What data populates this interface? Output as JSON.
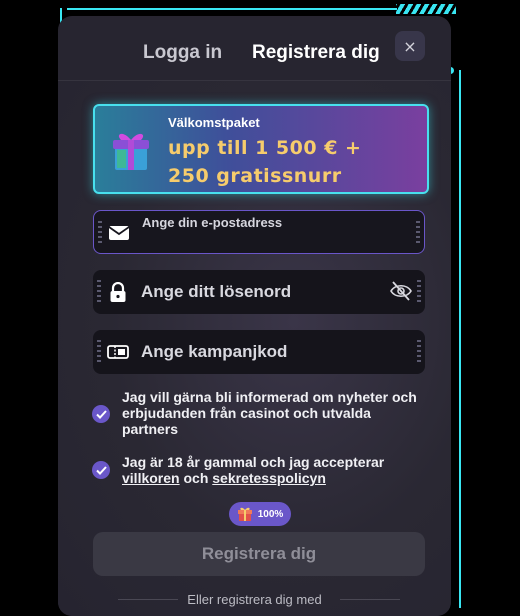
{
  "tabs": {
    "login": "Logga in",
    "register": "Registrera dig"
  },
  "close_icon": "×",
  "banner": {
    "title": "Välkomstpaket",
    "offer": "upp till 1 500 € + 250 gratissnurr",
    "icon": "gift-icon"
  },
  "fields": {
    "email": {
      "label": "Ange din e-postadress",
      "icon": "mail-icon"
    },
    "password": {
      "placeholder": "Ange ditt lösenord",
      "icon": "lock-icon",
      "toggle_icon": "eye-off-icon"
    },
    "promo": {
      "placeholder": "Ange kampanjkod",
      "icon": "ticket-icon"
    }
  },
  "consents": {
    "marketing": {
      "text": "Jag vill gärna bli informerad om nyheter och erbjudanden från casinot och utvalda partners",
      "checked": true
    },
    "terms": {
      "prefix": "Jag är 18 år gammal och jag accepterar ",
      "terms_link": "villkoren",
      "middle": " och ",
      "privacy_link": "sekretesspolicyn",
      "checked": true
    }
  },
  "progress": {
    "label": "100%",
    "value": 100
  },
  "submit_label": "Registrera dig",
  "alt_register": "Eller registrera dig med",
  "colors": {
    "accent": "#6a57c9",
    "cyan": "#39e6f2",
    "gold": "#f6cc6c",
    "magenta": "#e040e6"
  }
}
